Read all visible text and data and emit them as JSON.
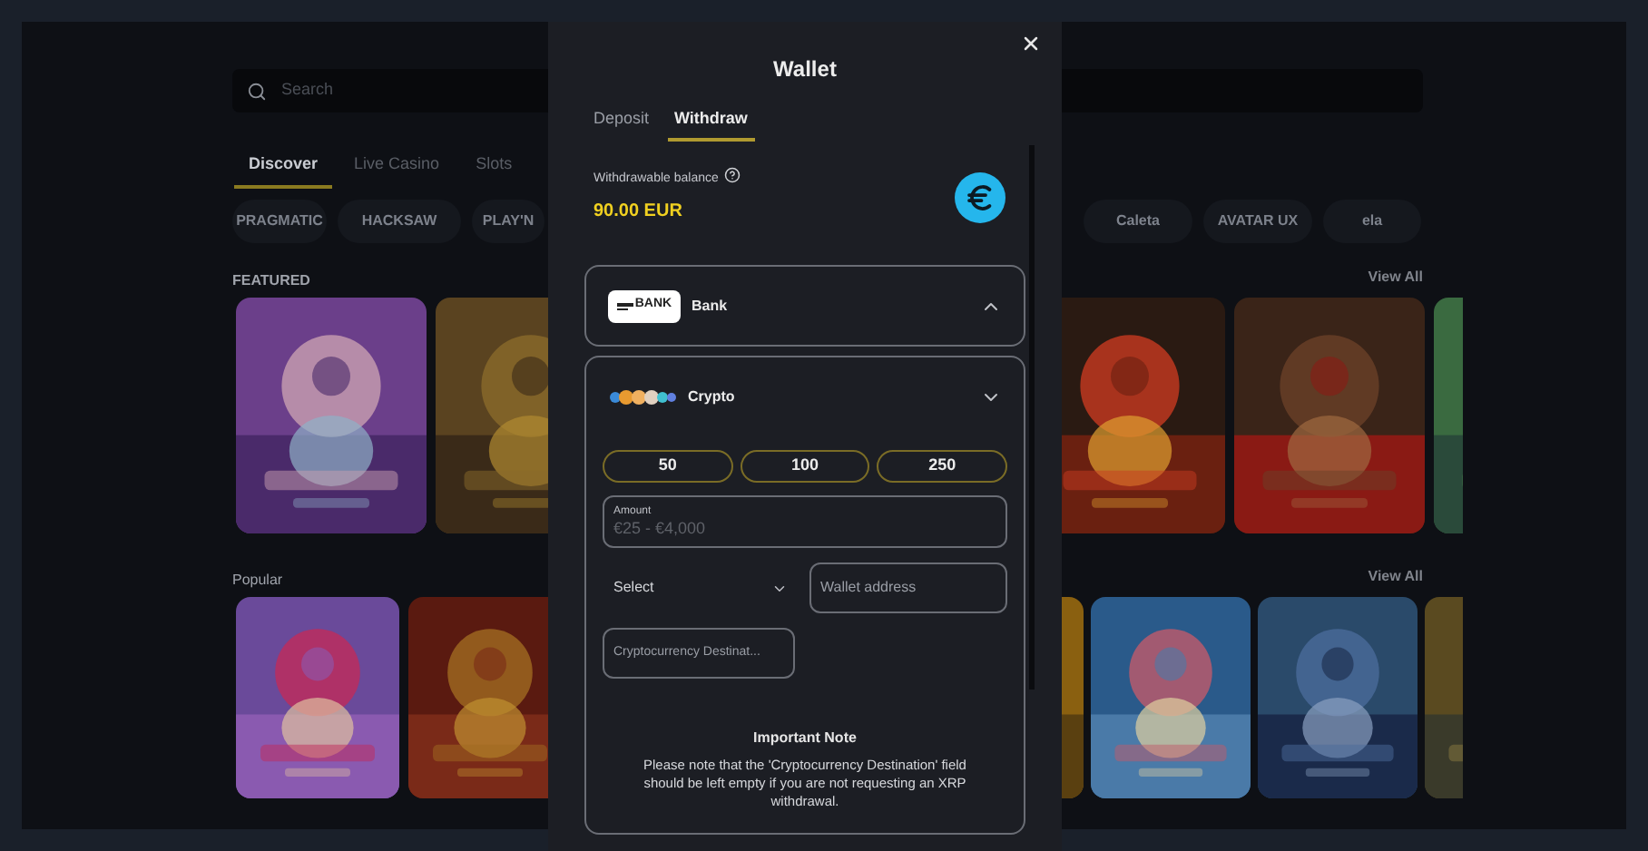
{
  "page": {
    "search": {
      "placeholder": "Search"
    },
    "tabs": [
      {
        "label": "Discover",
        "selected": true
      },
      {
        "label": "Live Casino",
        "selected": false
      },
      {
        "label": "Slots",
        "selected": false
      }
    ],
    "providers": {
      "left": [
        {
          "label": "PRAGMATIC"
        },
        {
          "label": "HACKSAW"
        },
        {
          "label": "PLAY'N"
        }
      ],
      "right": [
        {
          "label": "Caleta"
        },
        {
          "label": "AVATAR UX"
        },
        {
          "label": "ela"
        }
      ]
    },
    "sections": [
      {
        "title": "FEATURED",
        "link": "View All"
      },
      {
        "title": "Popular",
        "link": "View All"
      }
    ]
  },
  "wallet": {
    "title": "Wallet",
    "tabs": [
      {
        "label": "Deposit",
        "selected": false
      },
      {
        "label": "Withdraw",
        "selected": true
      }
    ],
    "balance": {
      "label": "Withdrawable balance",
      "amount": "90.00 EUR"
    },
    "methods": [
      {
        "kind": "bank",
        "logo_text": "BANK",
        "name": "Bank",
        "expanded": false
      },
      {
        "kind": "crypto",
        "name": "Crypto",
        "expanded": true,
        "form": {
          "quick_amounts": [
            "50",
            "100",
            "250"
          ],
          "amount": {
            "label": "Amount",
            "placeholder": "€25 - €4,000"
          },
          "select": {
            "value": "Select"
          },
          "wallet_address": {
            "placeholder": "Wallet address"
          },
          "destination": {
            "placeholder": "Cryptocurrency Destinat..."
          },
          "note": {
            "title": "Important Note",
            "text": "Please note that the 'Cryptocurrency Destination' field should be left empty if you are not requesting an XRP withdrawal."
          }
        }
      }
    ]
  }
}
